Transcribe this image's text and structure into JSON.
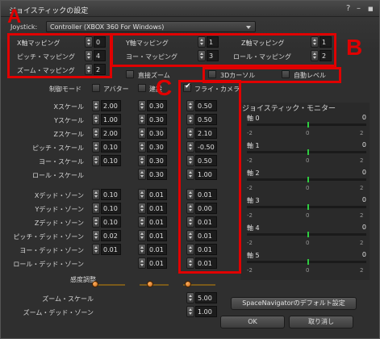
{
  "window": {
    "title": "ジョイスティックの設定",
    "help_glyph": "?",
    "minimize_glyph": "–",
    "close_glyph": "■"
  },
  "joystick": {
    "label": "Joystick:",
    "selected": "Controller (XBOX 360 For Windows)"
  },
  "mapping": {
    "x": {
      "label": "X軸マッピング",
      "value": "0"
    },
    "y": {
      "label": "Y軸マッピング",
      "value": "1"
    },
    "z": {
      "label": "Z軸マッピング",
      "value": "1"
    },
    "pitch": {
      "label": "ピッチ・マッピング",
      "value": "4"
    },
    "yaw": {
      "label": "ヨー・マッピング",
      "value": "3"
    },
    "roll": {
      "label": "ロール・マッピング",
      "value": "2"
    },
    "zoom": {
      "label": "ズーム・マッピング",
      "value": "2"
    }
  },
  "options": {
    "direct_zoom": "直接ズーム",
    "cursor3d": "3Dカーソル",
    "auto_level": "自動レベル"
  },
  "modes": {
    "label": "制御モード",
    "avatar": "アバター",
    "build": "建設",
    "flycam": "フライ・カメラ"
  },
  "scale_labels": [
    "Xスケール",
    "Yスケール",
    "Zスケール",
    "ピッチ・スケール",
    "ヨー・スケール",
    "ロール・スケール"
  ],
  "deadzone_labels": [
    "Xデッド・ゾーン",
    "Yデッド・ゾーン",
    "Zデッド・ゾーン",
    "ピッチ・デッド・ゾーン",
    "ヨー・デッド・ゾーン",
    "ロール・デッド・ゾーン"
  ],
  "avatar_scale": [
    "2.00",
    "1.00",
    "2.00",
    "0.10",
    "0.10",
    ""
  ],
  "build_scale": [
    "0.30",
    "0.30",
    "0.30",
    "0.30",
    "0.30",
    "0.30"
  ],
  "flycam_scale": [
    "0.50",
    "0.50",
    "2.10",
    "-0.50",
    "0.50",
    "1.00"
  ],
  "avatar_dead": [
    "0.10",
    "0.10",
    "0.10",
    "0.02",
    "0.01",
    ""
  ],
  "build_dead": [
    "0.01",
    "0.01",
    "0.01",
    "0.01",
    "0.01",
    "0.01"
  ],
  "flycam_dead": [
    "0.01",
    "0.00",
    "0.01",
    "0.01",
    "0.01",
    "0.01"
  ],
  "feather": {
    "label": "感度調整"
  },
  "zoom_scale": {
    "label": "ズーム・スケール",
    "value": "5.00"
  },
  "zoom_dead": {
    "label": "ズーム・デッド・ゾーン",
    "value": "1.00"
  },
  "monitor": {
    "title": "ジョイスティック・モニター",
    "axes": [
      {
        "name": "軸 0",
        "value": "0"
      },
      {
        "name": "軸 1",
        "value": "0"
      },
      {
        "name": "軸 2",
        "value": "0"
      },
      {
        "name": "軸 3",
        "value": "0"
      },
      {
        "name": "軸 4",
        "value": "0"
      },
      {
        "name": "軸 5",
        "value": "0"
      }
    ],
    "tick_min": "-2",
    "tick_mid": "0",
    "tick_max": "2"
  },
  "buttons": {
    "spacenav_default": "SpaceNavigatorのデフォルト設定",
    "ok": "OK",
    "cancel": "取り消し"
  },
  "annotations": {
    "a": "A",
    "b": "B",
    "c": "C"
  },
  "colors": {
    "annotation_red": "#e00000",
    "monitor_marker": "#2ecc40",
    "slider_knob": "#e08020"
  }
}
